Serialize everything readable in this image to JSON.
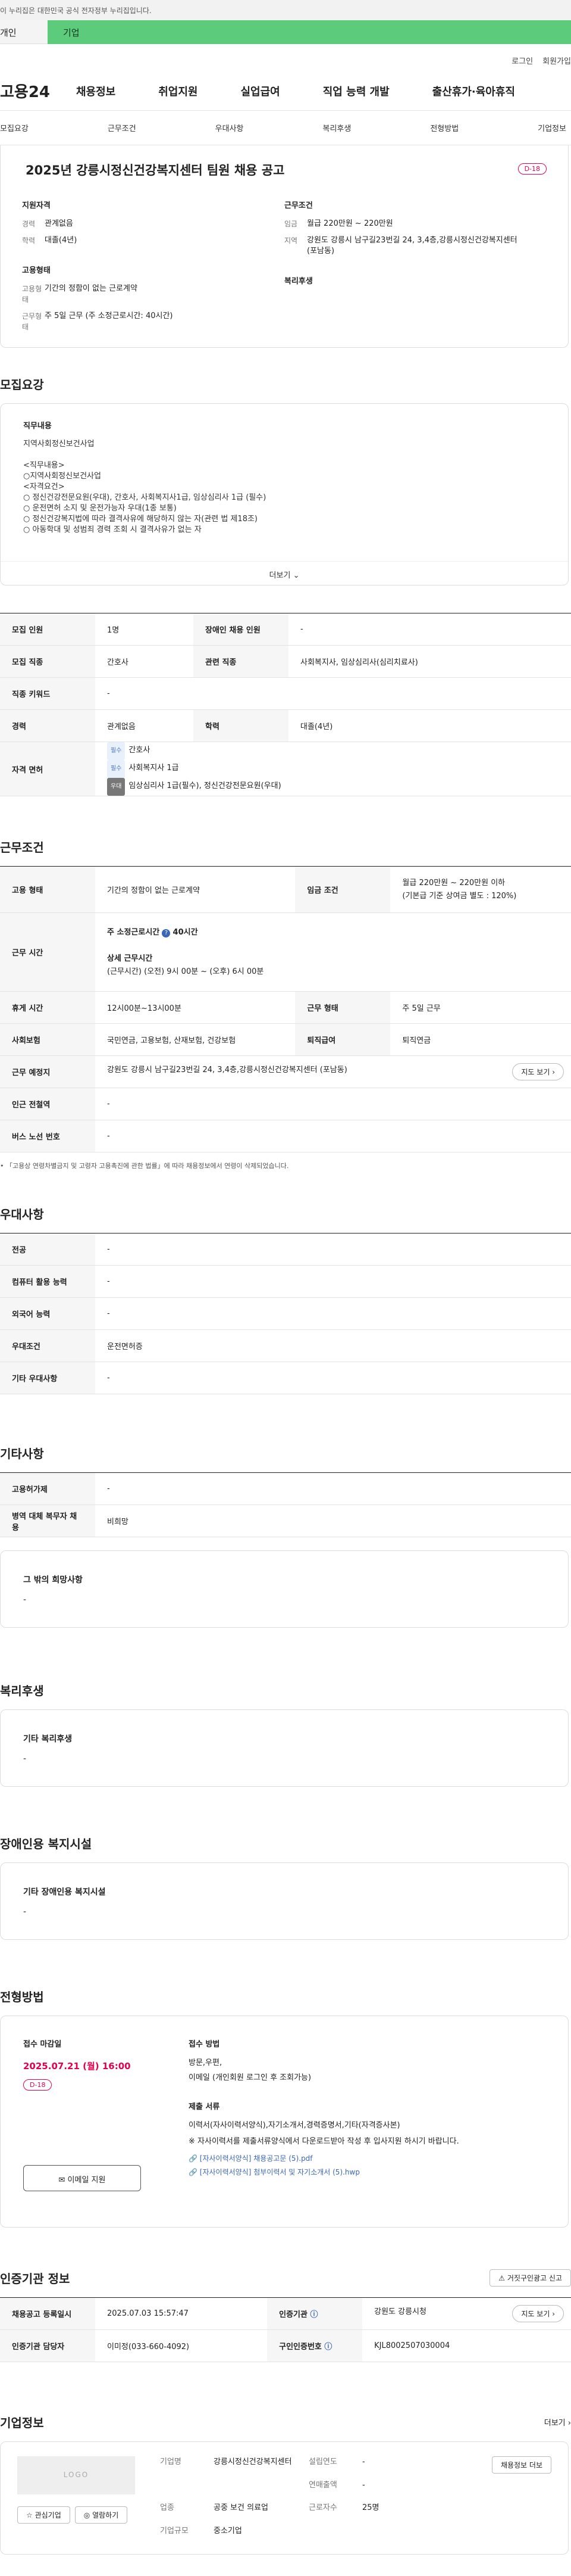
{
  "gov_banner": "이 누리집은 대한민국 공식 전자정부 누리집입니다.",
  "site_tabs": [
    "개인",
    "기업"
  ],
  "util_links": [
    "로그인",
    "회원가입"
  ],
  "gnb": {
    "logo": "고용24",
    "menu": [
      "채용정보",
      "취업지원",
      "실업급여",
      "직업 능력 개발",
      "출산휴가·육아휴직"
    ]
  },
  "subnav": [
    "모집요강",
    "근무조건",
    "우대사항",
    "복리후생",
    "전형방법",
    "기업정보"
  ],
  "summary": {
    "title": "2025년 강릉시정신건강복지센터 팀원 채용 공고",
    "dday": "D-18",
    "qualification": {
      "heading": "지원자격",
      "items": [
        {
          "k": "경력",
          "v": "관계없음"
        },
        {
          "k": "학력",
          "v": "대졸(4년)"
        }
      ]
    },
    "employment": {
      "heading": "고용형태",
      "items": [
        {
          "k": "고용형태",
          "v": "기간의 정함이 없는 근로계약"
        },
        {
          "k": "근무형태",
          "v": "주 5일 근무 (주 소정근로시간: 40시간)"
        }
      ]
    },
    "conditions": {
      "heading": "근무조건",
      "items": [
        {
          "k": "임금",
          "v": "월급 220만원 ~ 220만원"
        },
        {
          "k": "지역",
          "v": "강원도 강릉시 남구길23번길 24, 3,4층,강릉시정신건강복지센터 (포남동)"
        }
      ]
    },
    "welfare": {
      "heading": "복리후생"
    }
  },
  "recruit": {
    "title": "모집요강",
    "duty_heading": "직무내용",
    "duty_text": "지역사회정신보건사업\n\n<직무내용>\n○지역사회정신보건사업\n<자격요건>\n○ 정신건강전문요원(우대), 간호사, 사회복지사1급, 임상심리사 1급 (필수)\n○ 운전면허 소지 및 운전가능자 우대(1종 보통)\n○ 정신건강복지법에 따라 결격사유에 해당하지 않는 자(관련 법 제18조)\n○ 아동학대 및 성범죄 경력 조회 시 결격사유가 없는 자",
    "more": "더보기",
    "rows": {
      "count_k": "모집 인원",
      "count_v": "1명",
      "disabled_k": "장애인 채용 인원",
      "disabled_v": "-",
      "job_k": "모집 직종",
      "job_v": "간호사",
      "rel_k": "관련 직종",
      "rel_v": "사회복지사, 임상심리사(심리치료사)",
      "kw_k": "직종 키워드",
      "kw_v": "-",
      "career_k": "경력",
      "career_v": "관계없음",
      "edu_k": "학력",
      "edu_v": "대졸(4년)",
      "lic_k": "자격 면허",
      "licenses": [
        {
          "tag": "필수",
          "name": "간호사"
        },
        {
          "tag": "필수",
          "name": "사회복지사 1급"
        },
        {
          "tag": "우대",
          "name": "임상심리사 1급(필수), 정신건강전문요원(우대)"
        }
      ]
    }
  },
  "work": {
    "title": "근무조건",
    "type_k": "고용 형태",
    "type_v": "기간의 정함이 없는 근로계약",
    "wage_k": "임금 조건",
    "wage_v1": "월급 220만원 ~ 220만원 이하",
    "wage_v2": "(기본급 기준 상여금 별도 : 120%)",
    "hours_k": "근무 시간",
    "hours_v1": "주 소정근로시간",
    "hours_v1b": "40시간",
    "hours_v2": "상세 근무시간",
    "hours_v3": "(근무시간) (오전) 9시 00분 ~ (오후) 6시 00분",
    "rest_k": "휴게 시간",
    "rest_v": "12시00분~13시00분",
    "form_k": "근무 형태",
    "form_v": "주 5일 근무",
    "ins_k": "사회보험",
    "ins_v": "국민연금, 고용보험, 산재보험, 건강보험",
    "ret_k": "퇴직급여",
    "ret_v": "퇴직연금",
    "place_k": "근무 예정지",
    "place_v": "강원도 강릉시 남구길23번길 24, 3,4층,강릉시정신건강복지센터 (포남동)",
    "map_btn": "지도 보기",
    "subway_k": "인근 전철역",
    "subway_v": "-",
    "bus_k": "버스 노선 번호",
    "bus_v": "-",
    "note": "「고용상 연령차별금지 및 고령자 고용촉진에 관한 법률」에 따라 채용정보에서 연령이 삭제되었습니다."
  },
  "pref": {
    "title": "우대사항",
    "rows": [
      {
        "k": "전공",
        "v": "-"
      },
      {
        "k": "컴퓨터 활용 능력",
        "v": "-"
      },
      {
        "k": "외국어 능력",
        "v": "-"
      },
      {
        "k": "우대조건",
        "v": "운전면허증"
      },
      {
        "k": "기타 우대사항",
        "v": "-"
      }
    ]
  },
  "etc": {
    "title": "기타사항",
    "rows": [
      {
        "k": "고용허가제",
        "v": "-"
      },
      {
        "k": "병역 대체 복무자 채용",
        "v": "비희망"
      }
    ],
    "other_h": "그 밖의 희망사항",
    "other_v": "-"
  },
  "welfare_sec": {
    "title": "복리후생",
    "box_h": "기타 복리후생",
    "box_v": "-"
  },
  "disabled_sec": {
    "title": "장애인용 복지시설",
    "box_h": "기타 장애인용 복지시설",
    "box_v": "-"
  },
  "selection": {
    "title": "전형방법",
    "deadline_h": "접수 마감일",
    "deadline": "2025.07.21 (월) 16:00",
    "dday": "D-18",
    "email_btn": "이메일 지원",
    "method_h": "접수 방법",
    "method_v1": "방문,우편,",
    "method_v2": "이메일 (개인회원 로그인 후 조회가능)",
    "docs_h": "제출 서류",
    "docs_v1": "이력서(자사이력서양식),자기소개서,경력증명서,기타(자격증사본)",
    "docs_v2": "※ 자사이력서를 제출서류양식에서 다운로드받아 작성 후 입사지원 하시기 바랍니다.",
    "files": [
      "[자사이력서양식] 채용공고문 (5).pdf",
      "[자사이력서양식] 첨부이력서 및 자기소개서 (5).hwp"
    ]
  },
  "agency": {
    "title": "인증기관 정보",
    "report_btn": "거짓구인광고 신고",
    "reg_k": "채용공고 등록일시",
    "reg_v": "2025.07.03 15:57:47",
    "org_k": "인증기관",
    "org_v": "강원도 강릉시청",
    "map_btn": "지도 보기",
    "mgr_k": "인증기관 담당자",
    "mgr_v": "이미정(033-660-4092)",
    "no_k": "구인인증번호",
    "no_v": "KJL8002507030004"
  },
  "company": {
    "title": "기업정보",
    "more": "더보기",
    "logo": "LOGO",
    "fav_btn": "관심기업",
    "follow_btn": "열람하기",
    "name_k": "기업명",
    "name_v": "강릉시정신건강복지센터",
    "year_k": "설립연도",
    "year_v": "-",
    "sales_k": "연매출액",
    "sales_v": "-",
    "ind_k": "업종",
    "ind_v": "공중 보건 의료업",
    "emp_k": "근로자수",
    "emp_v": "25명",
    "size_k": "기업규모",
    "size_v": "중소기업",
    "homepage_btn": "채용정보 더보"
  }
}
